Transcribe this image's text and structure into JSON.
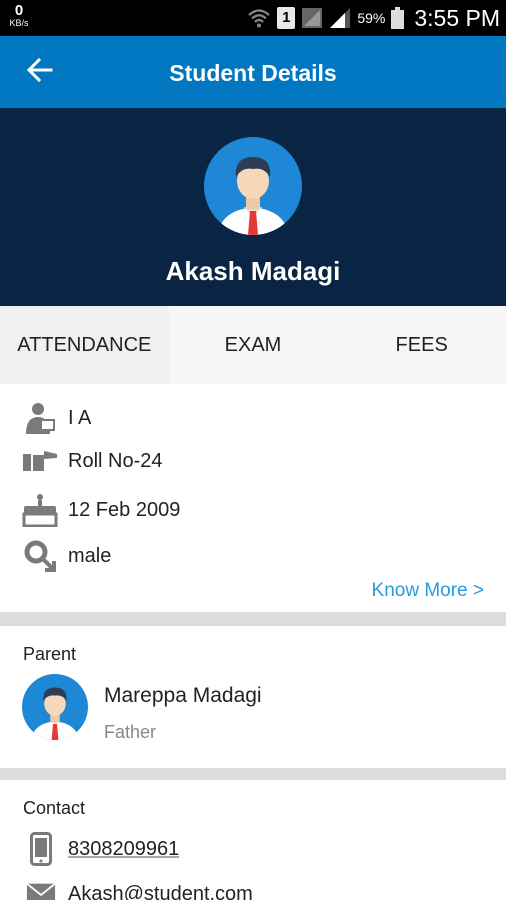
{
  "status_bar": {
    "kb_value": "0",
    "kb_unit": "KB/s",
    "sim_slot": "1",
    "battery": "59%",
    "time": "3:55 PM"
  },
  "app_bar": {
    "title": "Student Details",
    "back_icon": "arrow-left-icon"
  },
  "student": {
    "name": "Akash Madagi",
    "avatar_icon": "student-avatar"
  },
  "tabs": [
    {
      "label": "ATTENDANCE"
    },
    {
      "label": "EXAM"
    },
    {
      "label": "FEES"
    }
  ],
  "info": {
    "class": "I A",
    "roll": "Roll No-24",
    "dob": "12 Feb 2009",
    "gender": "male",
    "know_more": "Know More >"
  },
  "parent": {
    "section_label": "Parent",
    "name": "Mareppa Madagi",
    "relation": "Father"
  },
  "contact": {
    "section_label": "Contact",
    "phone": "8308209961",
    "email": "Akash@student.com"
  },
  "colors": {
    "app_bar": "#0077c0",
    "hero": "#0a2543",
    "link": "#2a9ad8",
    "icon_gray": "#7a7a7a"
  }
}
